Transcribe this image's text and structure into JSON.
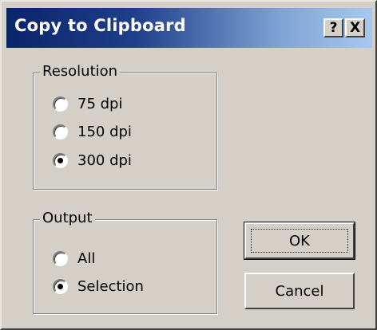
{
  "window": {
    "title": "Copy to Clipboard",
    "help_button": "?",
    "close_button": "X"
  },
  "resolution": {
    "legend": "Resolution",
    "options": [
      "75 dpi",
      "150 dpi",
      "300 dpi"
    ],
    "selected": "300 dpi"
  },
  "output": {
    "legend": "Output",
    "options": [
      "All",
      "Selection"
    ],
    "selected": "Selection"
  },
  "buttons": {
    "ok_label": "OK",
    "cancel_label": "Cancel"
  }
}
